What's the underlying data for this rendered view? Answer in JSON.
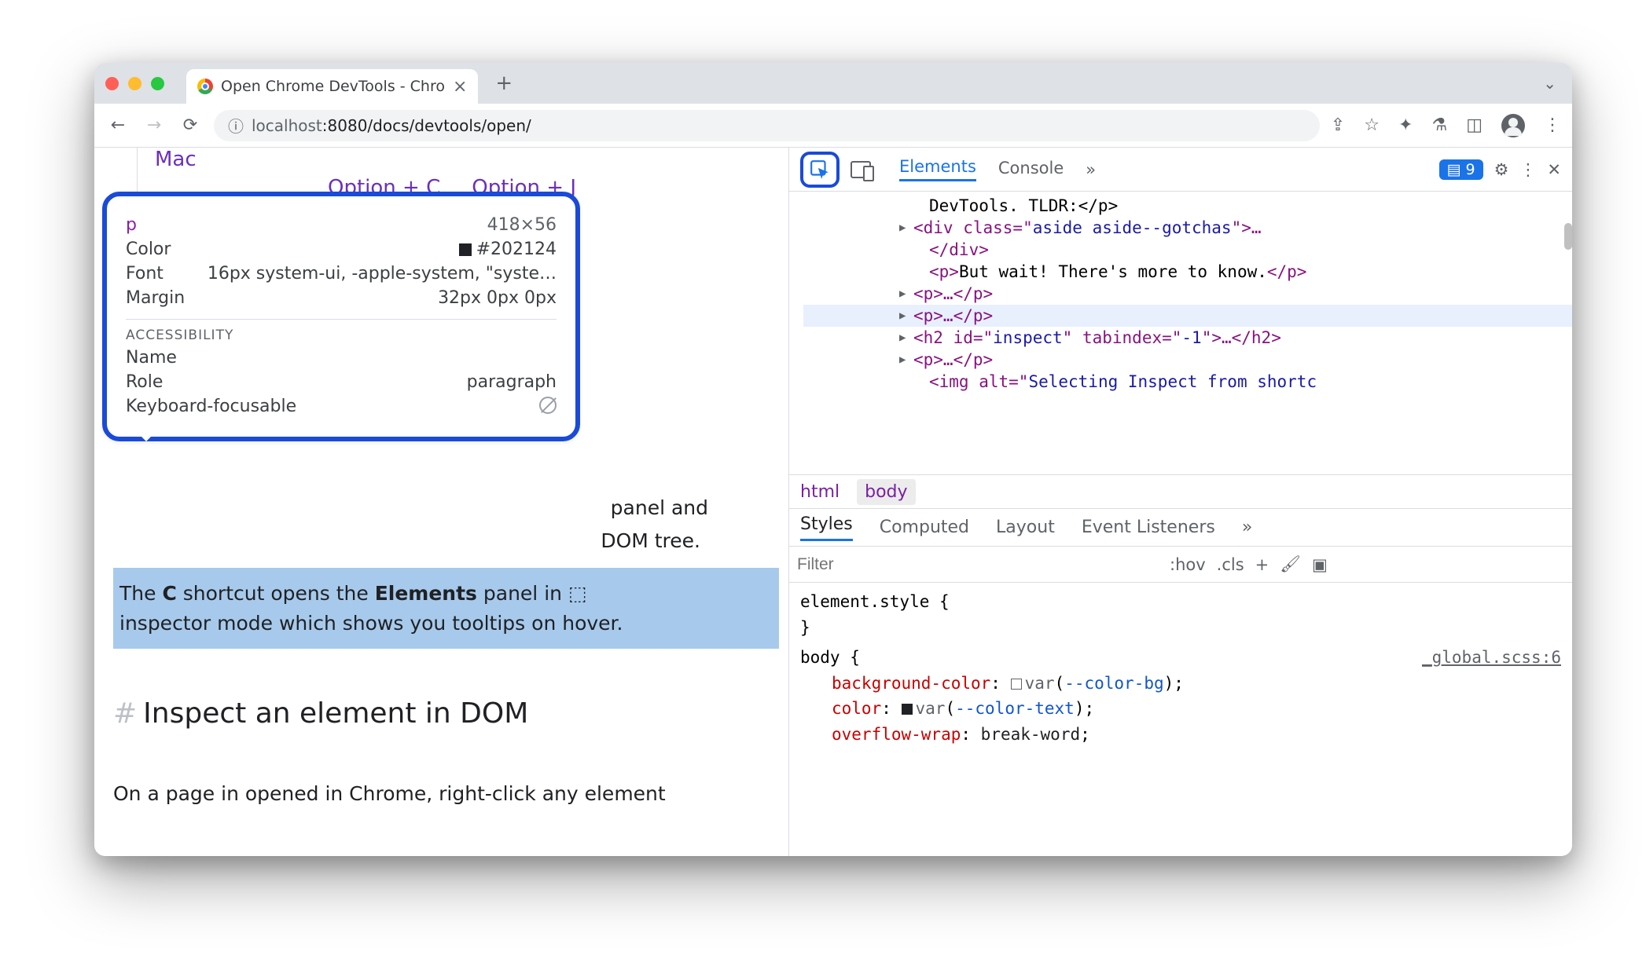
{
  "tab": {
    "title": "Open Chrome DevTools - Chro"
  },
  "toolbar": {},
  "url": {
    "scheme": "localhost",
    "port_path": ":8080/docs/devtools/open/"
  },
  "page": {
    "mac": "Mac",
    "kbd_c": "Option + C",
    "kbd_j": "Option + J",
    "panel_suffix_1": "panel and",
    "panel_suffix_2": "DOM tree.",
    "hl_pre": "The ",
    "hl_c": "C",
    "hl_mid": " shortcut opens the ",
    "hl_el": "Elements",
    "hl_post_1": " panel in ",
    "hl_line2": "inspector mode which shows you tooltips on hover.",
    "heading": "Inspect an element in DOM",
    "body_p": "On a page in opened in Chrome, right-click any element"
  },
  "hover": {
    "tag": "p",
    "dims": "418×56",
    "color_l": "Color",
    "color_v": "#202124",
    "font_l": "Font",
    "font_v": "16px system-ui, -apple-system, \"syste…",
    "margin_l": "Margin",
    "margin_v": "32px 0px 0px",
    "a11y": "ACCESSIBILITY",
    "name_l": "Name",
    "role_l": "Role",
    "role_v": "paragraph",
    "kf_l": "Keyboard-focusable"
  },
  "dt": {
    "tabs": {
      "elements": "Elements",
      "console": "Console"
    },
    "chip_count": "9",
    "dom_l0": "DevTools. TLDR:</p>",
    "dom_l1a": "<div class=\"",
    "dom_l1b": "aside aside--gotchas",
    "dom_l1c": "\">…",
    "dom_l1d": "</div>",
    "dom_l2a": "<p>",
    "dom_l2b": "But wait! There's more to know.",
    "dom_l2c": "</p>",
    "dom_l3": "<p>…</p>",
    "dom_l4": "<p>…</p>",
    "dom_l5a": "<h2 id=\"",
    "dom_l5b": "inspect",
    "dom_l5c": "\" tabindex=\"",
    "dom_l5d": "-1",
    "dom_l5e": "\">…</h2>",
    "dom_l6": "<p>…</p>",
    "dom_l7a": "<img alt=\"",
    "dom_l7b": "Selecting Inspect from shortc",
    "crumbs": {
      "html": "html",
      "body": "body"
    },
    "styletabs": {
      "styles": "Styles",
      "computed": "Computed",
      "layout": "Layout",
      "ev": "Event Listeners"
    },
    "filter_ph": "Filter",
    "hov": ":hov",
    "cls": ".cls",
    "elstyle_l1": "element.style {",
    "elstyle_l2": "}",
    "body_open": "body {",
    "src": "_global.scss:6",
    "p_bg": "background-color",
    "v_bg_var": "var",
    "v_bg_link": "--color-bg",
    "p_col": "color",
    "v_col_var": "var",
    "v_col_link": "--color-text",
    "p_ow": "overflow-wrap",
    "v_ow": "break-word"
  }
}
